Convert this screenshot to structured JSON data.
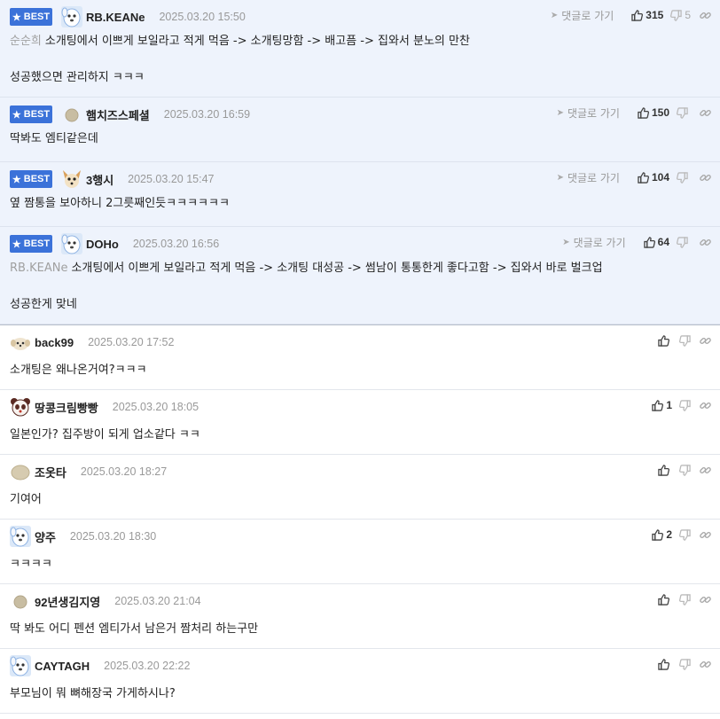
{
  "best_label": "BEST",
  "reply_label": "댓글로 가기",
  "best_comments": [
    {
      "nick": "RB.KEANe",
      "date": "2025.03.20 15:50",
      "mention": "순순희",
      "lines": [
        "소개팅에서 이쁘게 보일라고 적게 먹음 -> 소개팅망함 -> 배고픔 -> 집와서 분노의 만찬",
        "",
        "성공했으면 관리하지 ㅋㅋㅋ"
      ],
      "likes": "315",
      "dislikes": "5",
      "avatar": "white-dog-avatar"
    },
    {
      "nick": "햄치즈스페셜",
      "date": "2025.03.20 16:59",
      "mention": "",
      "lines": [
        "딱봐도 엠티같은데"
      ],
      "likes": "150",
      "dislikes": "",
      "avatar": "gray-dot-avatar"
    },
    {
      "nick": "3행시",
      "date": "2025.03.20 15:47",
      "mention": "",
      "lines": [
        "옆 짬통을 보아하니 2그릇째인듯ㅋㅋㅋㅋㅋㅋ"
      ],
      "likes": "104",
      "dislikes": "",
      "avatar": "chihuahua-avatar"
    },
    {
      "nick": "DOHo",
      "date": "2025.03.20 16:56",
      "mention": "RB.KEANe",
      "lines": [
        "소개팅에서 이쁘게 보일라고 적게 먹음 -> 소개팅 대성공 -> 썸남이 통통한게 좋다고함 -> 집와서 바로 벌크업",
        "",
        "성공한게 맞네"
      ],
      "likes": "64",
      "dislikes": "",
      "avatar": "white-dog-avatar"
    }
  ],
  "comments": [
    {
      "nick": "back99",
      "date": "2025.03.20 17:52",
      "text": "소개팅은 왜나온거여?ㅋㅋㅋ",
      "likes": "",
      "avatar": "puppy-avatar"
    },
    {
      "nick": "땅콩크림빵빵",
      "date": "2025.03.20 18:05",
      "text": "일본인가? 집주방이 되게 업소같다 ㅋㅋ",
      "likes": "1",
      "avatar": "panda-avatar"
    },
    {
      "nick": "조옷타",
      "date": "2025.03.20 18:27",
      "text": "기여어",
      "likes": "",
      "avatar": "beige-blob-avatar"
    },
    {
      "nick": "양주",
      "date": "2025.03.20 18:30",
      "text": "ㅋㅋㅋㅋ",
      "likes": "2",
      "avatar": "white-dog-avatar"
    },
    {
      "nick": "92년생김지영",
      "date": "2025.03.20 21:04",
      "text": "딱 봐도 어디 펜션 엠티가서 남은거 짬처리 하는구만",
      "likes": "",
      "avatar": "gray-dot-avatar"
    },
    {
      "nick": "CAYTAGH",
      "date": "2025.03.20 22:22",
      "text": "부모님이 뭐 뼈해장국 가게하시나?",
      "likes": "",
      "avatar": "white-dog-avatar"
    }
  ],
  "colors": {
    "best_bg": "#eef3fc",
    "badge": "#3b72d9",
    "muted": "#999999"
  }
}
